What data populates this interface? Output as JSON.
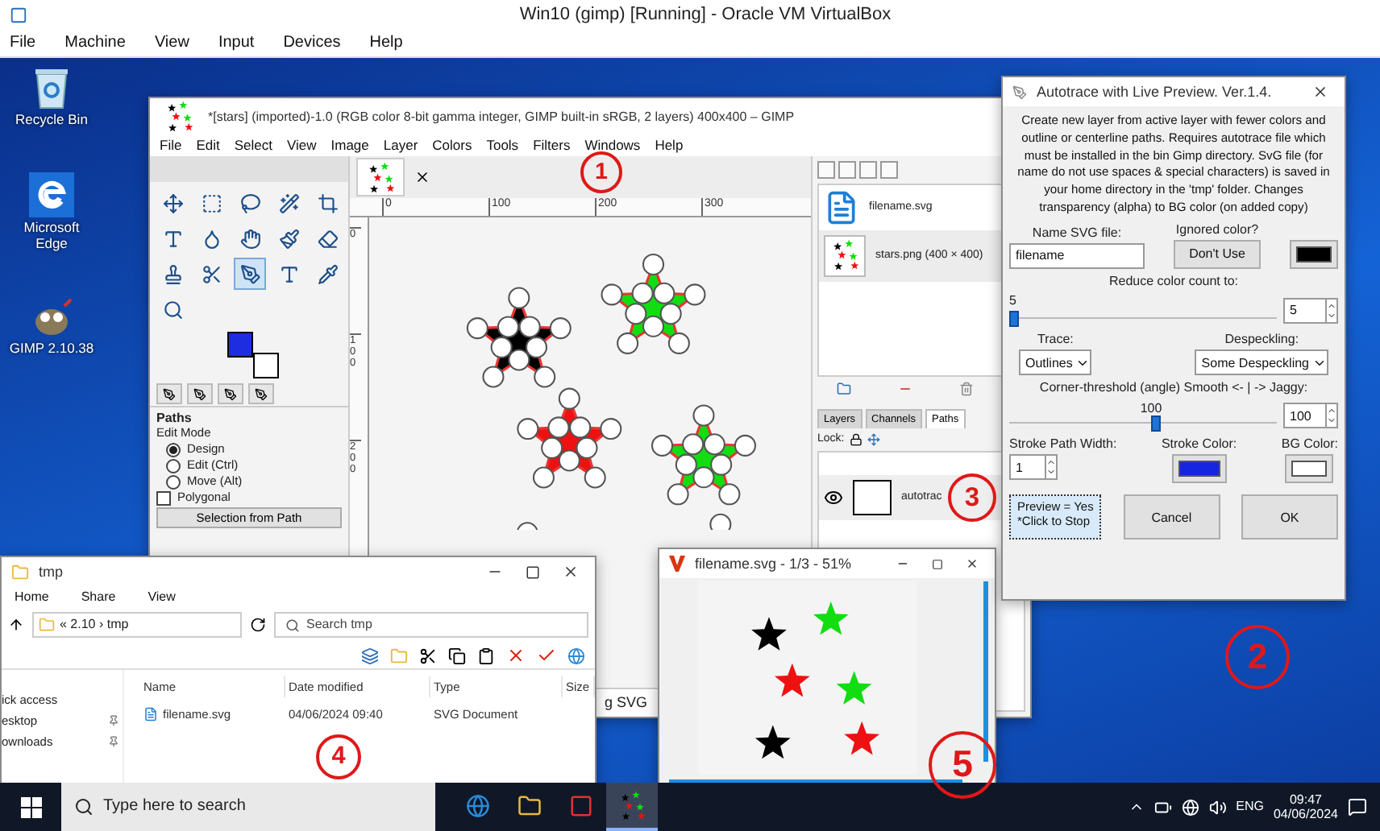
{
  "vm_window": {
    "title": "Win10 (gimp) [Running] - Oracle VM VirtualBox",
    "menu": [
      "File",
      "Machine",
      "View",
      "Input",
      "Devices",
      "Help"
    ]
  },
  "desktop_icons": [
    {
      "label": "Recycle Bin",
      "kind": "recycle"
    },
    {
      "label": "Microsoft Edge",
      "kind": "edge"
    },
    {
      "label": "GIMP 2.10.38",
      "kind": "gimp"
    }
  ],
  "gimp": {
    "title": "*[stars] (imported)-1.0 (RGB color 8-bit gamma integer, GIMP built-in sRGB, 2 layers) 400x400 – GIMP",
    "menu": [
      "File",
      "Edit",
      "Select",
      "View",
      "Image",
      "Layer",
      "Colors",
      "Tools",
      "Filters",
      "Windows",
      "Help"
    ],
    "tool_options": {
      "title": "Paths",
      "edit_mode_label": "Edit Mode",
      "modes": [
        {
          "label": "Design",
          "selected": true
        },
        {
          "label": "Edit (Ctrl)",
          "selected": false
        },
        {
          "label": "Move (Alt)",
          "selected": false
        }
      ],
      "polygonal": {
        "label": "Polygonal",
        "checked": false
      },
      "button": "Selection from Path"
    },
    "ruler_marks": [
      "0",
      "100",
      "200",
      "300"
    ],
    "vertical_ruler_marks": [
      "0",
      "100",
      "200"
    ],
    "images": [
      {
        "label": "filename.svg",
        "kind": "svg"
      },
      {
        "label": "stars.png (400 × 400)",
        "kind": "png"
      }
    ],
    "dock_tabs": [
      {
        "label": "Layers",
        "selected": false
      },
      {
        "label": "Channels",
        "selected": false
      },
      {
        "label": "Paths",
        "selected": true
      }
    ],
    "lock_label": "Lock:",
    "path_name": "autotrac",
    "status": "g SVG"
  },
  "autotrace": {
    "title": "Autotrace with Live Preview. Ver.1.4.",
    "description": "Create new layer from active layer with fewer colors and outline or centerline paths. Requires autotrace file which must be installed in the bin Gimp directory. SvG file (for name do not use spaces & special characters) is saved in your home directory in the 'tmp' folder. Changes transparency (alpha) to BG color (on added copy)",
    "name_label": "Name SVG file:",
    "name_value": "filename",
    "ignored_label": "Ignored color?",
    "ignored_button": "Don't Use",
    "reduce": {
      "label": "Reduce color count to:",
      "reading": "5",
      "level": 0.0,
      "value": "5"
    },
    "trace_label": "Trace:",
    "trace_value": "Outlines",
    "despeckle_label": "Despeckling:",
    "despeckle_value": "Some Despeckling",
    "corner": {
      "label": "Corner-threshold (angle) Smooth <- | -> Jaggy:",
      "reading": "100",
      "level": 0.55,
      "value": "100"
    },
    "stroke_width_label": "Stroke Path Width:",
    "stroke_width_value": "1",
    "stroke_color_label": "Stroke Color:",
    "bg_color_label": "BG Color:",
    "preview_button": [
      "Preview = Yes",
      "*Click to Stop"
    ],
    "cancel_button": "Cancel",
    "ok_button": "OK"
  },
  "explorer": {
    "title": "tmp",
    "ribbon_tabs": [
      "Home",
      "Share",
      "View"
    ],
    "address": "« 2.10 › tmp",
    "search_placeholder": "Search tmp",
    "nav": [
      {
        "label": "ick access",
        "pinned": false
      },
      {
        "label": "esktop",
        "pinned": true
      },
      {
        "label": "ownloads",
        "pinned": true
      }
    ],
    "columns": [
      "Name",
      "Date modified",
      "Type",
      "Size"
    ],
    "rows": [
      {
        "name": "filename.svg",
        "date": "04/06/2024 09:40",
        "type": "SVG Document"
      }
    ]
  },
  "preview": {
    "title": "filename.svg - 1/3 - 51%"
  },
  "taskbar": {
    "search_placeholder": "Type here to search",
    "language": "ENG",
    "time": "09:47",
    "date": "04/06/2024"
  },
  "annotations": [
    "1",
    "2",
    "3",
    "4",
    "5"
  ]
}
